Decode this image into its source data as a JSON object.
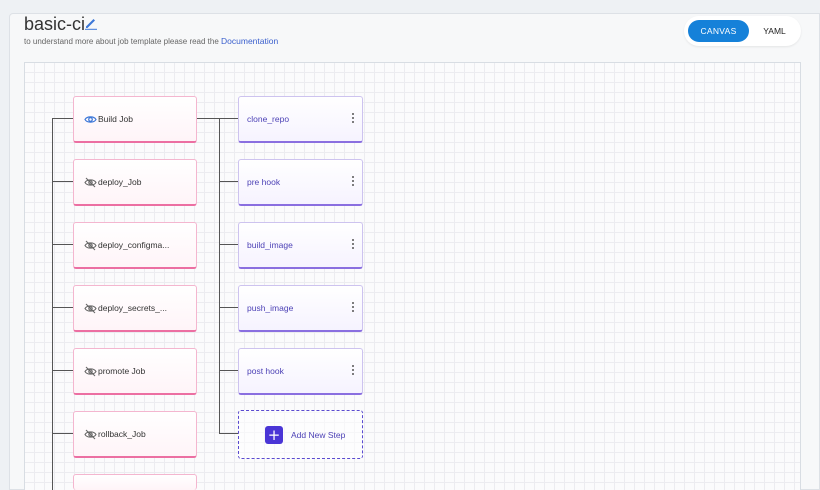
{
  "header": {
    "title": "basic-ci",
    "subtitle_text": "to understand more about job template please read the ",
    "doc_link": "Documentation"
  },
  "view_toggle": {
    "options": [
      "CANVAS",
      "YAML"
    ],
    "selected": "CANVAS"
  },
  "jobs": [
    {
      "label": "Build Job",
      "icon": "eye-icon"
    },
    {
      "label": "deploy_Job",
      "icon": "eye-off-icon"
    },
    {
      "label": "deploy_configma...",
      "icon": "eye-off-icon"
    },
    {
      "label": "deploy_secrets_...",
      "icon": "eye-off-icon"
    },
    {
      "label": "promote Job",
      "icon": "eye-off-icon"
    },
    {
      "label": "rollback_Job",
      "icon": "eye-off-icon"
    }
  ],
  "steps": [
    {
      "label": "clone_repo"
    },
    {
      "label": "pre hook"
    },
    {
      "label": "build_image"
    },
    {
      "label": "push_image"
    },
    {
      "label": "post hook"
    }
  ],
  "add_step": {
    "label": "Add New Step",
    "icon": "plus-icon"
  },
  "colors": {
    "accent": "#1581d9",
    "job_border": "#ec6fa2",
    "step_border": "#8a6fe0",
    "add_step": "#4a35d6"
  }
}
